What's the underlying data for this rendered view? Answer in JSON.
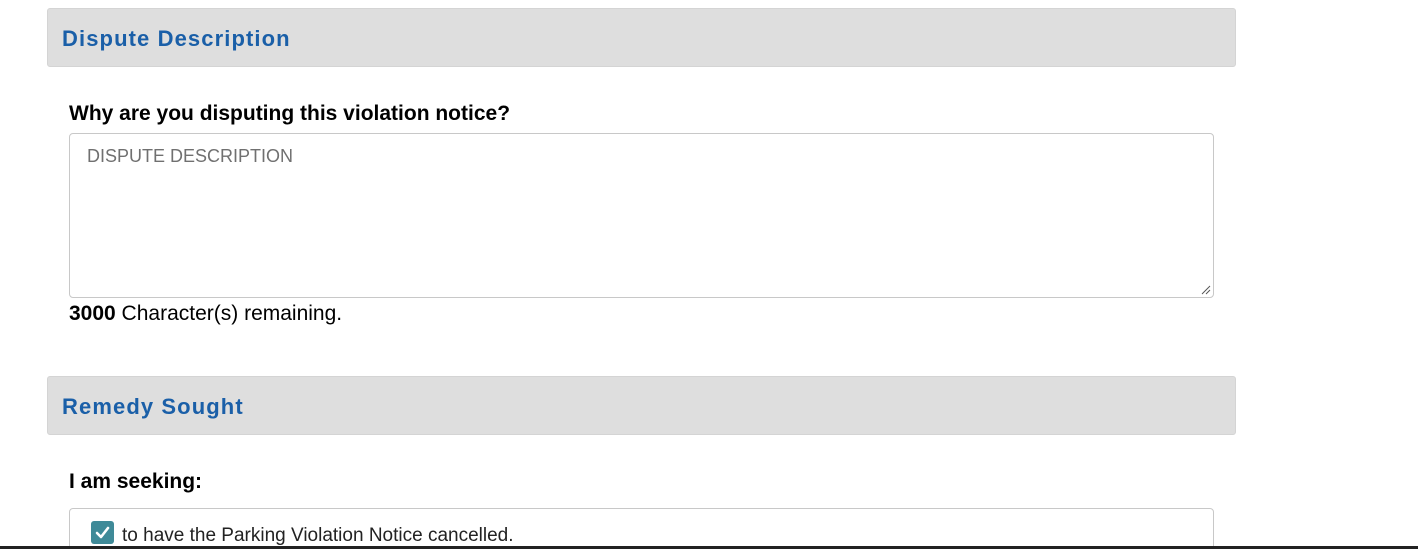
{
  "sections": {
    "dispute": {
      "title": "Dispute Description",
      "question": "Why are you disputing this violation notice?",
      "textarea": {
        "placeholder": "DISPUTE DESCRIPTION",
        "value": ""
      },
      "char_count": "3000",
      "char_suffix": " Character(s) remaining."
    },
    "remedy": {
      "title": "Remedy Sought",
      "question": "I am seeking:",
      "options": [
        {
          "label": "to have the Parking Violation Notice cancelled.",
          "checked": true
        }
      ]
    }
  },
  "colors": {
    "header_bg": "#dedede",
    "header_text": "#1a5fa8",
    "checkbox": "#3f8a98"
  }
}
